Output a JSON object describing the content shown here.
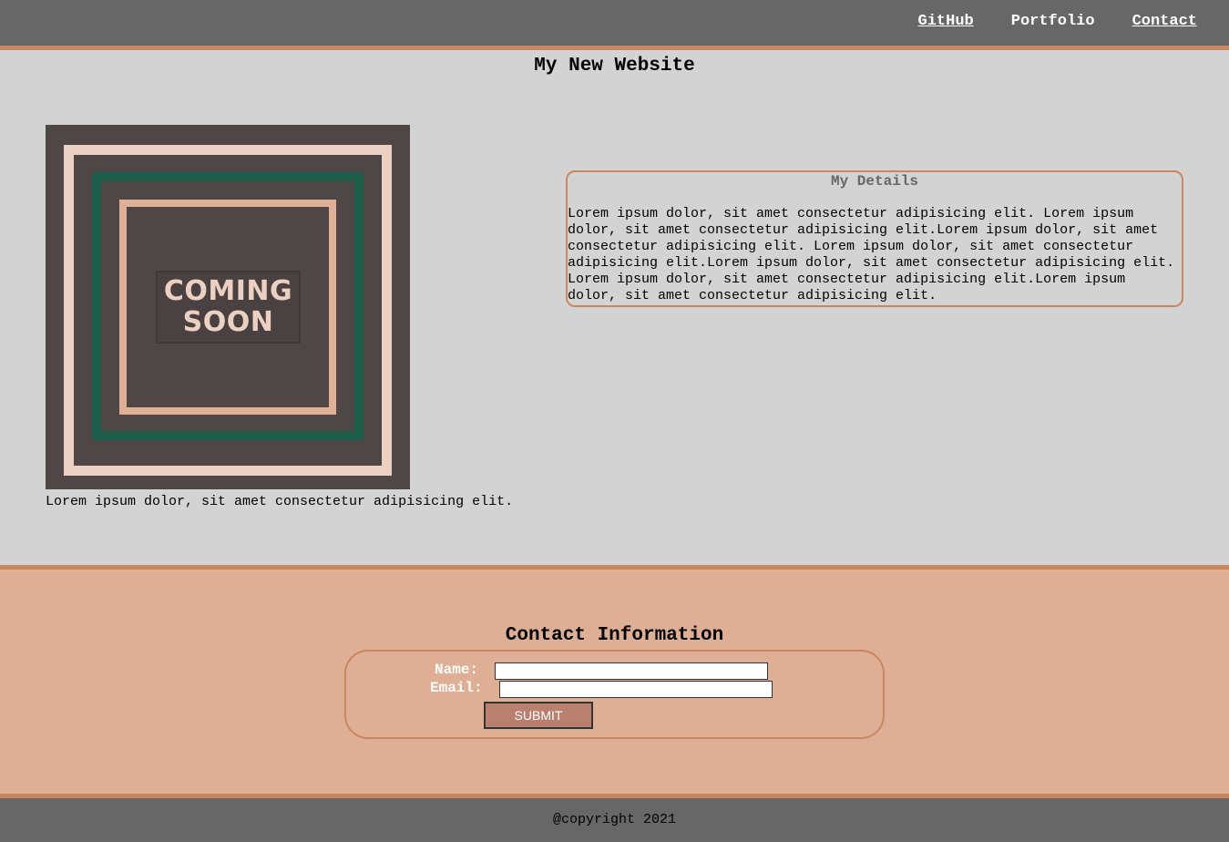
{
  "nav": {
    "items": [
      {
        "label": "GitHub"
      },
      {
        "label": "Portfolio"
      },
      {
        "label": "Contact"
      }
    ]
  },
  "main": {
    "title": "My New Website",
    "poster": {
      "text_line1": "COMING",
      "text_line2": "SOON"
    },
    "caption": "Lorem ipsum dolor, sit amet consectetur adipisicing elit."
  },
  "details": {
    "title": "My Details",
    "body": "Lorem ipsum dolor, sit amet consectetur adipisicing elit. Lorem ipsum dolor, sit amet consectetur adipisicing elit.Lorem ipsum dolor, sit amet consectetur adipisicing elit. Lorem ipsum dolor, sit amet consectetur adipisicing elit.Lorem ipsum dolor, sit amet consectetur adipisicing elit. Lorem ipsum dolor, sit amet consectetur adipisicing elit.Lorem ipsum dolor, sit amet consectetur adipisicing elit."
  },
  "contact": {
    "title": "Contact Information",
    "name_label": "Name:",
    "name_value": "",
    "email_label": "Email:",
    "email_value": "",
    "submit_label": "Submit"
  },
  "footer": {
    "copyright": "@copyright 2021"
  },
  "colors": {
    "topbar": "#676767",
    "accent": "#c98660",
    "main_bg": "#d3d3d3",
    "contact_bg": "#dfaf95",
    "poster_bg": "#4f4646",
    "poster_green": "#1c5e4a",
    "poster_cream": "#ecd0c1",
    "submit_bg": "#b98070"
  }
}
